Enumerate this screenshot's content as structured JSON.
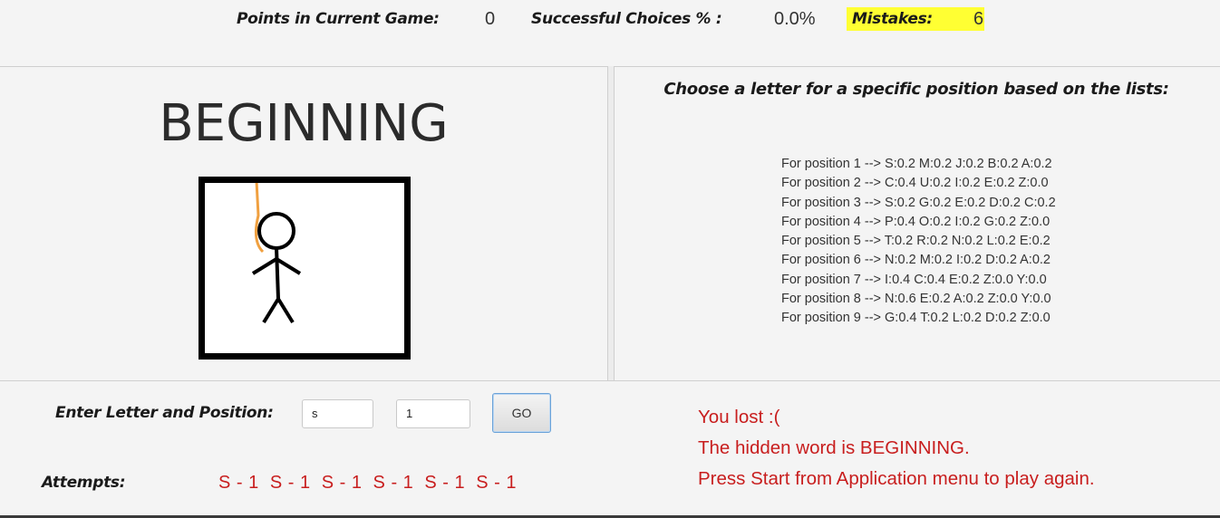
{
  "stats": {
    "points_label": "Points in Current Game:",
    "points_value": "0",
    "success_label": "Successful Choices % :",
    "success_value": "0.0%",
    "mistakes_label": "Mistakes:",
    "mistakes_value": "6"
  },
  "game": {
    "word": "BEGINNING"
  },
  "suggestions": {
    "title": "Choose a letter for a specific position based on the lists:",
    "lines": [
      "For position 1 --> S:0.2 M:0.2 J:0.2 B:0.2 A:0.2",
      "For position 2 --> C:0.4 U:0.2 I:0.2 E:0.2 Z:0.0",
      "For position 3 --> S:0.2 G:0.2 E:0.2 D:0.2 C:0.2",
      "For position 4 --> P:0.4 O:0.2 I:0.2 G:0.2 Z:0.0",
      "For position 5 --> T:0.2 R:0.2 N:0.2 L:0.2 E:0.2",
      "For position 6 --> N:0.2 M:0.2 I:0.2 D:0.2 A:0.2",
      "For position 7 --> I:0.4 C:0.4 E:0.2 Z:0.0 Y:0.0",
      "For position 8 --> N:0.6 E:0.2 A:0.2 Z:0.0 Y:0.0",
      "For position 9 --> G:0.4 T:0.2 L:0.2 D:0.2 Z:0.0"
    ]
  },
  "controls": {
    "enter_label": "Enter Letter and Position:",
    "letter_value": "s",
    "position_value": "1",
    "go_label": "GO"
  },
  "attempts": {
    "label": "Attempts:",
    "value": "S - 1  S - 1  S - 1  S - 1  S - 1  S - 1"
  },
  "result": {
    "line1": "You lost :(",
    "line2": "The hidden word is BEGINNING.",
    "line3": "Press Start from Application menu to play again."
  },
  "colors": {
    "highlight": "#ffff33",
    "error_red": "#c81e1e",
    "rope": "#f0a040"
  }
}
